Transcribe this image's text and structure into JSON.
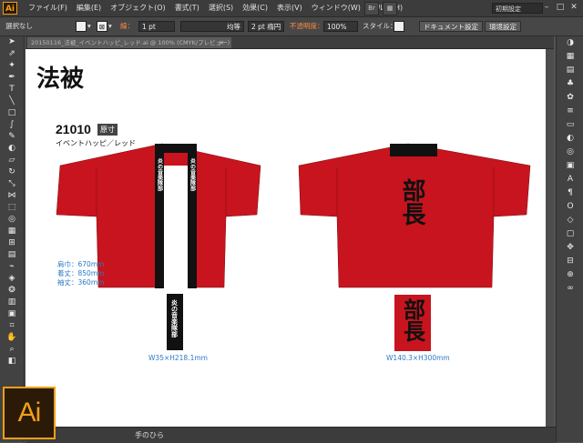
{
  "app": {
    "logo": "Ai",
    "workspace": "初期設定"
  },
  "menu": [
    "ファイル(F)",
    "編集(E)",
    "オブジェクト(O)",
    "書式(T)",
    "選択(S)",
    "効果(C)",
    "表示(V)",
    "ウィンドウ(W)",
    "ヘルプ(H)"
  ],
  "control": {
    "selection": "選択なし",
    "stroke_label": "線：",
    "stroke_value": "1 pt",
    "stroke_style": "均等",
    "brush": "2 pt 楕円",
    "opacity_label": "不透明度：",
    "opacity_value": "100%",
    "style_label": "スタイル：",
    "doc_settings": "ドキュメント設定",
    "preferences": "環境設定"
  },
  "tab": {
    "title": "20150116_法被_イベントハッピ_レッド.ai @ 100% (CMYK/プレビュー)",
    "close": "×"
  },
  "status": {
    "tool_name": "手のひら"
  },
  "artboard": {
    "title": "法被",
    "product_code": "21010",
    "badge": "原寸",
    "product_name": "イベントハッピ／レッド",
    "dims": [
      "肩巾：670mm",
      "着丈：850mm",
      "袖丈：360mm"
    ],
    "collar_text": "炎の音楽隊部",
    "back_text": "部長",
    "caption_left": "W35×H218.1mm",
    "caption_right": "W140.3×H300mm"
  },
  "colors": {
    "happi_red": "#c8141e",
    "accent": "#f29f17",
    "caption_blue": "#2a7ac4"
  }
}
